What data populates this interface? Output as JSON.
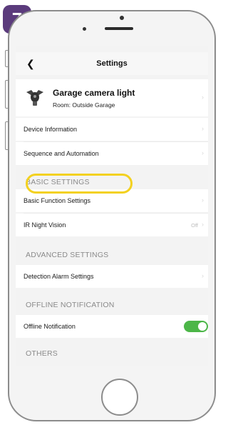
{
  "step_badge": "7",
  "nav": {
    "title": "Settings",
    "back_icon": "chevron-left-icon"
  },
  "device": {
    "name": "Garage camera light",
    "room": "Room: Outside Garage",
    "icon": "camera-icon"
  },
  "rows_top": [
    {
      "label": "Device Information"
    },
    {
      "label": "Sequence and Automation"
    }
  ],
  "sections": {
    "basic": "BASIC SETTINGS",
    "advanced": "ADVANCED SETTINGS",
    "offline": "OFFLINE NOTIFICATION",
    "others": "OTHERS"
  },
  "basic_rows": [
    {
      "label": "Basic Function Settings"
    },
    {
      "label": "IR Night Vision",
      "value": "Off"
    }
  ],
  "advanced_rows": [
    {
      "label": "Detection Alarm Settings"
    }
  ],
  "offline_rows": [
    {
      "label": "Offline Notification",
      "toggle_on": true,
      "toggle_color": "#4cb648"
    }
  ],
  "colors": {
    "badge": "#5b3b7c",
    "highlight": "#f3d120"
  }
}
